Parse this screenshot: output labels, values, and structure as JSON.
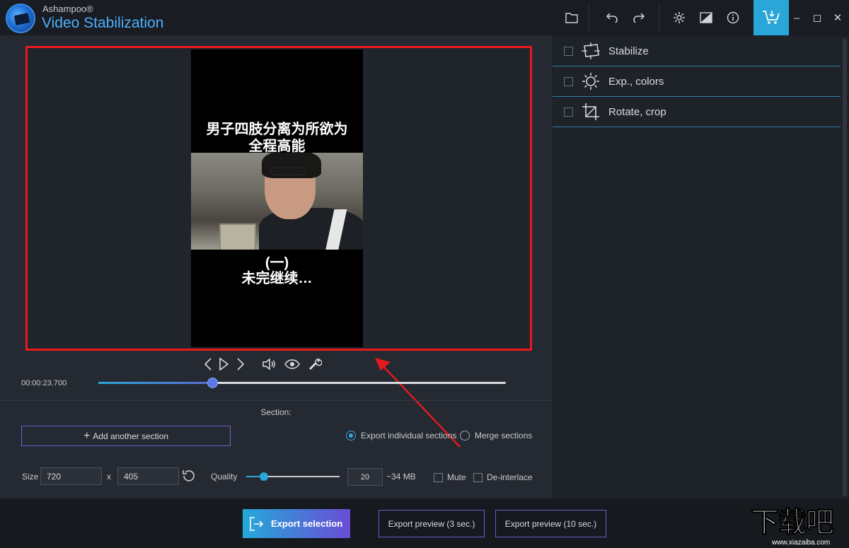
{
  "titlebar": {
    "brand_small": "Ashampoo®",
    "brand_big": "Video Stabilization",
    "icons": [
      "folder-icon",
      "undo-icon",
      "redo-icon",
      "settings-gear-icon",
      "compare-icon",
      "info-icon",
      "cart-download-icon"
    ],
    "window_controls": [
      "–",
      "◻",
      "✕"
    ]
  },
  "preview": {
    "subtitle_top_1": "男子四肢分离为所欲为",
    "subtitle_top_2": "全程高能",
    "subtitle_bottom_1": "(一)",
    "subtitle_bottom_2": "未完继续…",
    "highlight_color": "#e8191c"
  },
  "playback": {
    "icons": [
      "prev-frame-icon",
      "play-icon",
      "next-frame-icon",
      "volume-icon",
      "eye-icon",
      "wrench-icon"
    ],
    "timecode": "00:00:23.700",
    "progress_fraction": 0.28
  },
  "section": {
    "label": "Section:",
    "add_button": "Add another section",
    "radio_individual": "Export individual sections",
    "radio_merge": "Merge sections",
    "selected_mode": "individual"
  },
  "output": {
    "size_label": "Size",
    "width": "720",
    "times": "x",
    "height": "405",
    "quality_label": "Quality",
    "quality_fraction": 0.19,
    "quality_value": "20",
    "file_size": "~34 MB",
    "mute_label": "Mute",
    "deinterlace_label": "De-interlace"
  },
  "effects": [
    {
      "label": "Stabilize",
      "icon": "stabilize-icon"
    },
    {
      "label": "Exp., colors",
      "icon": "sun-icon"
    },
    {
      "label": "Rotate, crop",
      "icon": "crop-icon"
    }
  ],
  "footer": {
    "export_selection": "Export selection",
    "preview_3": "Export preview (3 sec.)",
    "preview_10": "Export preview (10 sec.)",
    "accent_start": "#25a9d8",
    "accent_end": "#6a4cd6"
  },
  "watermark": {
    "chars": "下载吧",
    "url": "www.xiazaiba.com"
  }
}
